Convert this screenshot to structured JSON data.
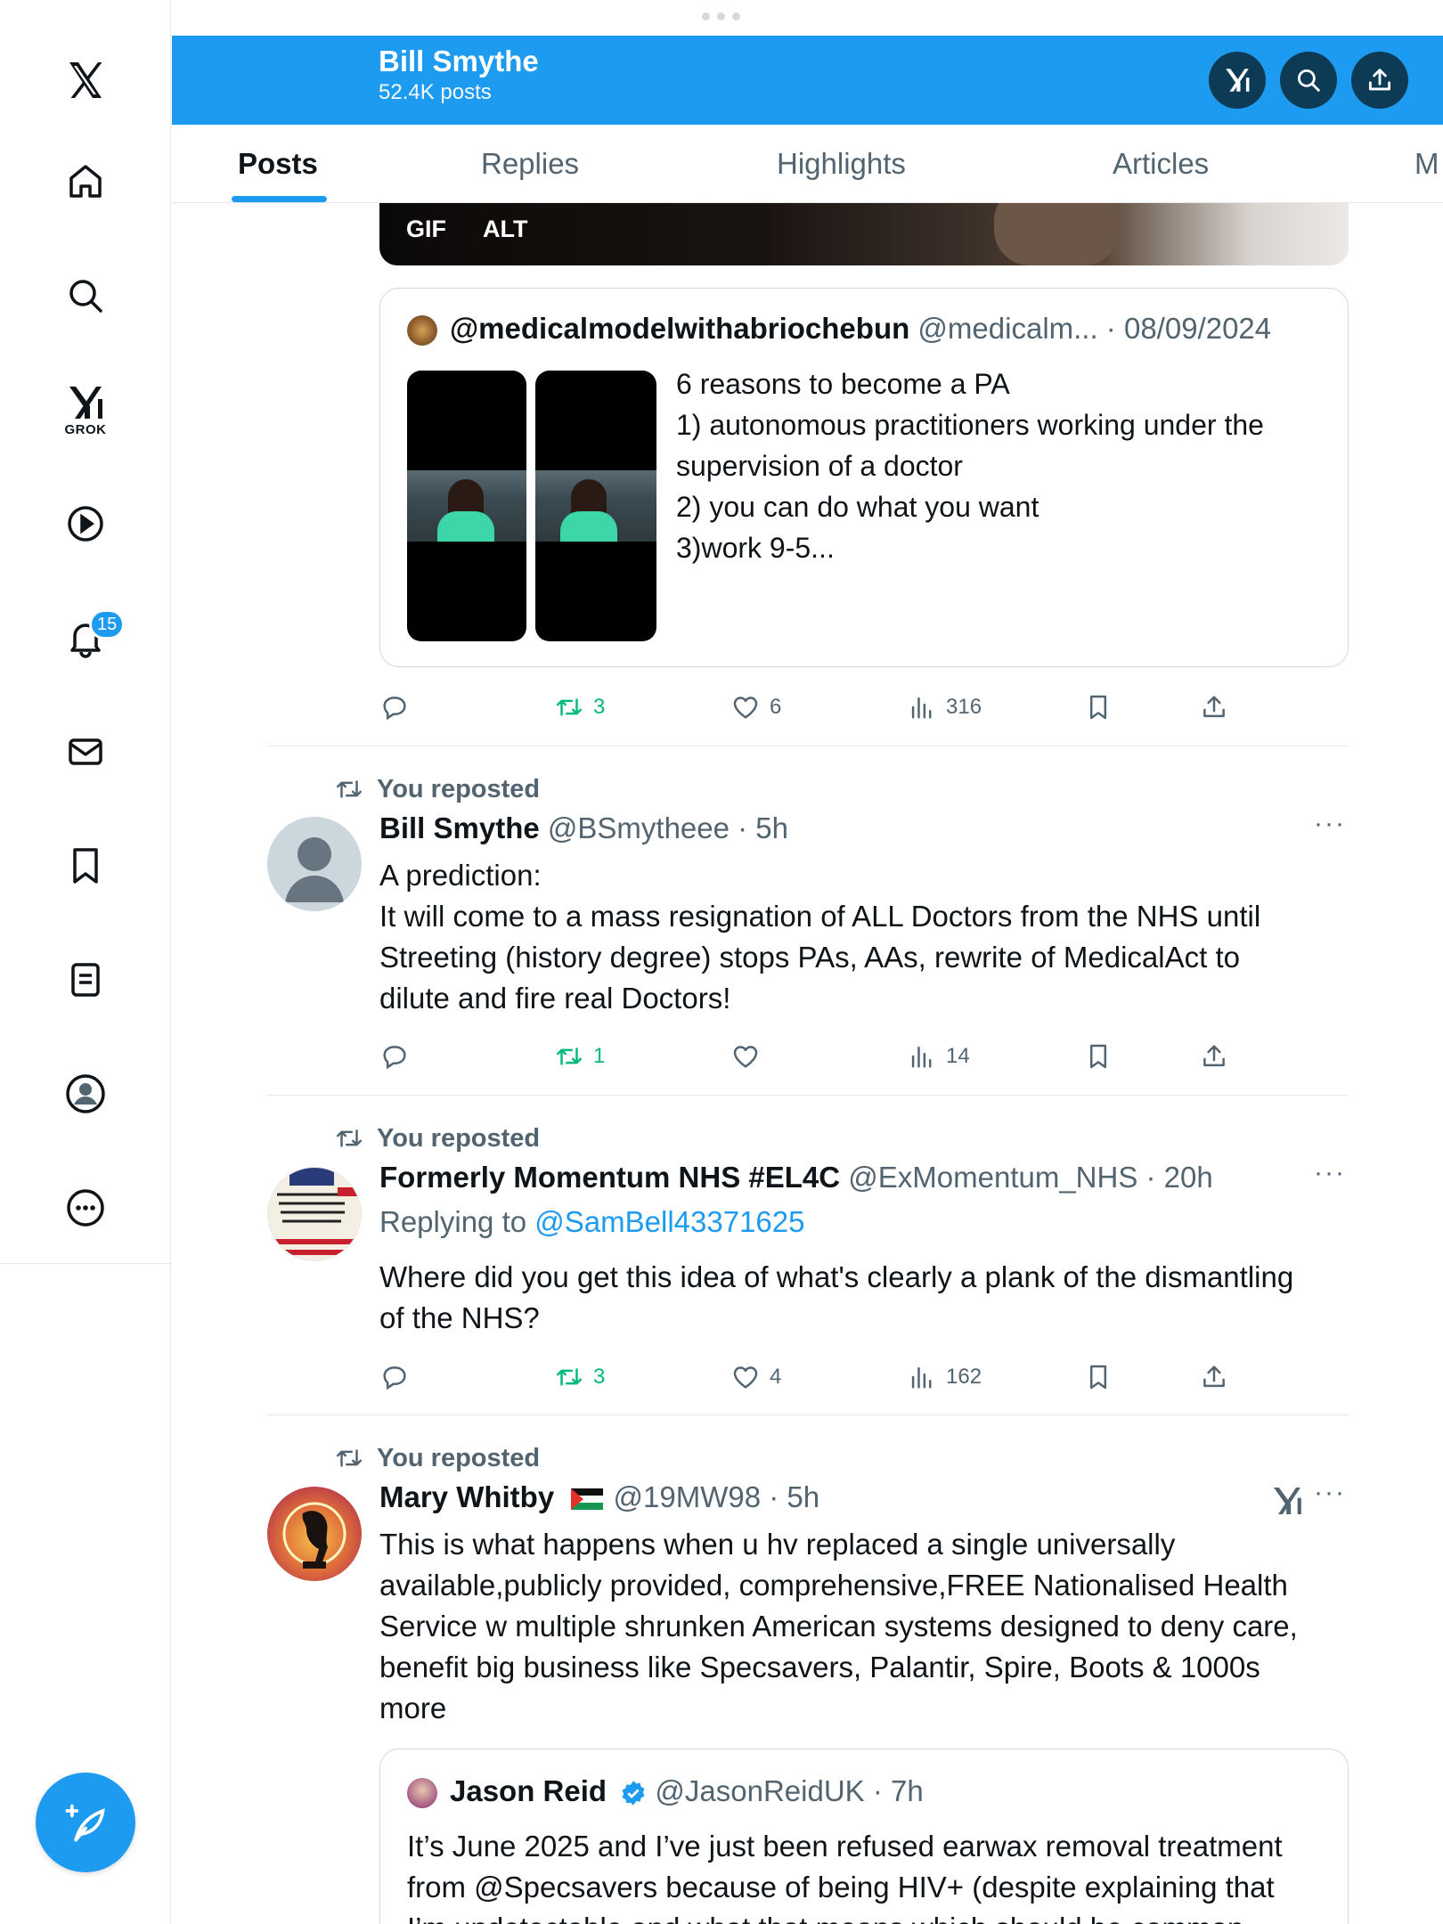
{
  "nav": {
    "grok_label": "GROK",
    "notification_count": "15"
  },
  "header": {
    "title": "Bill Smythe",
    "subtitle": "52.4K posts"
  },
  "tabs": [
    "Posts",
    "Replies",
    "Highlights",
    "Articles",
    "M"
  ],
  "media": {
    "gif_label": "GIF",
    "alt_label": "ALT"
  },
  "quoted_post_1": {
    "name": "@medicalmodelwithabriochebun",
    "meta": " @medicalm... · 08/09/2024",
    "lines": [
      "6 reasons to become a PA",
      "1) autonomous practitioners working under the",
      "supervision of a doctor",
      "2) you can do what you want",
      "3)work 9-5..."
    ]
  },
  "post_0_actions": {
    "reposts": "3",
    "likes": "6",
    "views": "316"
  },
  "posts": [
    {
      "repost_label": "You reposted",
      "name": "Bill Smythe",
      "meta": " @BSmytheee · 5h",
      "lines": [
        "A prediction:",
        "It will come to a mass resignation of ALL Doctors from the NHS until",
        "Streeting (history degree) stops PAs, AAs, rewrite of MedicalAct to",
        "dilute and fire real Doctors!"
      ],
      "reposts": "1",
      "likes": "",
      "views": "14"
    },
    {
      "repost_label": "You reposted",
      "name": "Formerly Momentum NHS #EL4C",
      "meta": " @ExMomentum_NHS · 20h",
      "replying_prefix": "Replying to ",
      "replying_handle": "@SamBell43371625",
      "lines": [
        "Where did you get this idea of what's clearly a plank of the dismantling",
        "of the NHS?"
      ],
      "reposts": "3",
      "likes": "4",
      "views": "162"
    },
    {
      "repost_label": "You reposted",
      "name": "Mary Whitby",
      "meta": " @19MW98 · 5h",
      "lines": [
        "This is what happens when u hv replaced a single universally",
        "available,publicly provided, comprehensive,FREE Nationalised Health",
        "Service w multiple shrunken American systems designed to deny care,",
        "benefit big business like Specsavers, Palantir, Spire, Boots & 1000s",
        "more"
      ]
    }
  ],
  "quoted_post_2": {
    "name": "Jason Reid",
    "meta": " @JasonReidUK · 7h",
    "lines": [
      "It’s June 2025 and I’ve just been refused earwax removal treatment",
      "from @Specsavers because of being HIV+ (despite explaining that",
      "I’m undetectable and what that means which should be common"
    ]
  },
  "colors": {
    "accent": "#1d9bf0",
    "repost_green": "#00ba7c",
    "secondary_text": "#536471"
  }
}
